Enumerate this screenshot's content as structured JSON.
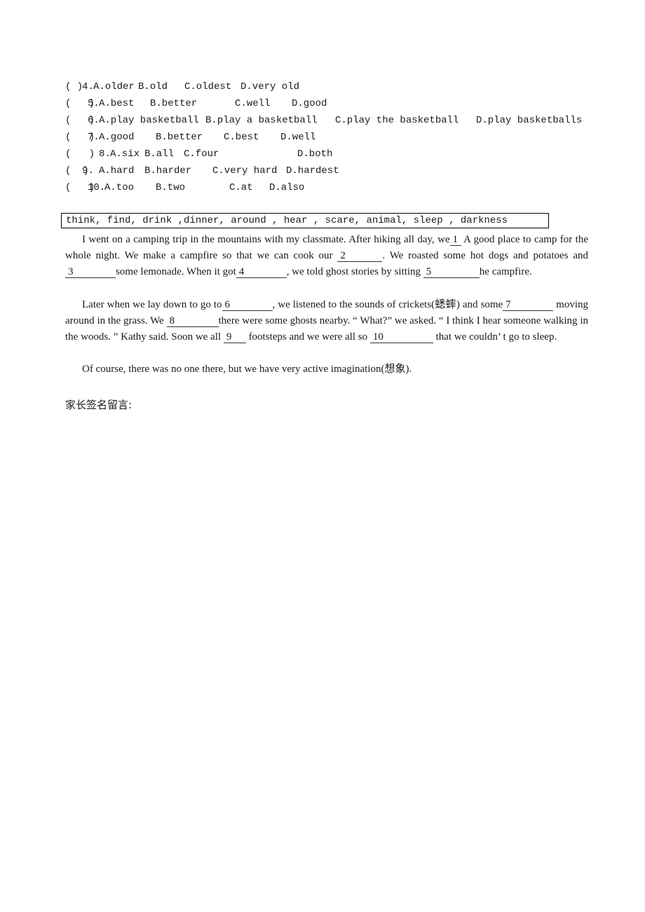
{
  "choices": [
    {
      "paren": "( )",
      "number": "4.",
      "options": [
        "A.older",
        "B.old",
        "C.oldest",
        "D.very old"
      ]
    },
    {
      "paren": "(   )",
      "number": "5.",
      "options": [
        "A.best",
        "B.better",
        "C.well",
        "D.good"
      ]
    },
    {
      "paren": "(   )",
      "number": "6.",
      "options": [
        "A.play basketball",
        "B.play a basketball",
        "C.play the basketball",
        "D.play basketballs"
      ]
    },
    {
      "paren": "(   )",
      "number": "7.",
      "options": [
        "A.good",
        "B.better",
        "C.best",
        "D.well"
      ]
    },
    {
      "paren": "(   )",
      "number": "8.",
      "options": [
        "A.six",
        "B.all",
        "C.four",
        "D.both"
      ]
    },
    {
      "paren": "(  )",
      "number": "9.",
      "options": [
        "A.hard",
        "B.harder",
        "C.very hard",
        "D.hardest"
      ]
    },
    {
      "paren": "(   )",
      "number": "10.",
      "options": [
        "A.too",
        "B.two",
        "C.at",
        "D.also"
      ]
    }
  ],
  "word_bank": "think, find, drink ,dinner, around , hear , scare, animal, sleep , darkness",
  "passage": {
    "p1": {
      "s1": "I went on a camping trip in the mountains with my classmate. After hiking all day, we",
      "b1": "1",
      "s2": "A good place to camp for the whole night. We make a campfire so that we can cook our ",
      "b2": "2",
      "s3": ". We roasted some hot dogs and potatoes and",
      "b3": "3",
      "s4": "some lemonade. When it got",
      "b4": "4",
      "s5": ", we told ghost stories by sitting ",
      "b5": "5",
      "s6": "he campfire."
    },
    "p2": {
      "s1": "Later when we lay down to go to",
      "b6": "6",
      "s2": ", we listened to the sounds of crickets(蟋蟀) and some",
      "b7": "7",
      "s3": " moving around in the grass. We ",
      "b8": "8",
      "s4": "there were some ghosts nearby. “ What?” we asked. “ I think I hear someone walking in the woods. ” Kathy said. Soon we all ",
      "b9": "9",
      "s5": " footsteps and we were all so ",
      "b10": "10",
      "s6": "  that we couldn’ t go to sleep."
    },
    "p3": "Of course, there was no one there, but we have very active imagination(想象)."
  },
  "parent_signature_label": "家长签名留言:"
}
